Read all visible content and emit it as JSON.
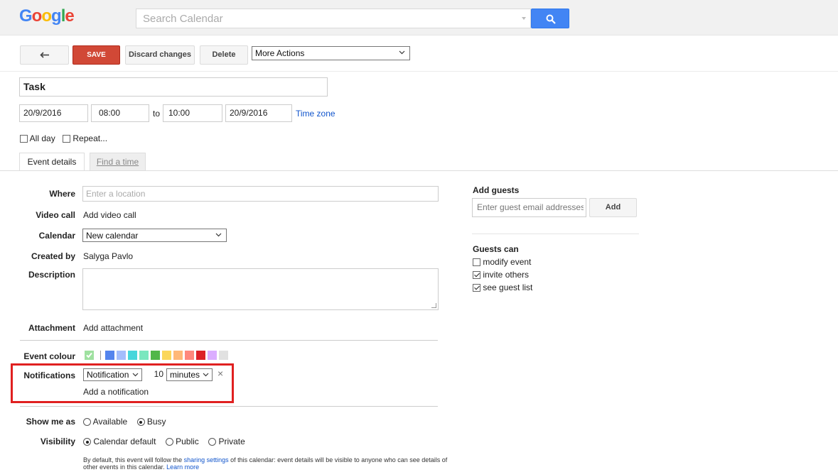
{
  "header": {
    "logo_letters": [
      {
        "ch": "G",
        "color": "#4285f4"
      },
      {
        "ch": "o",
        "color": "#ea4335"
      },
      {
        "ch": "o",
        "color": "#fbbc05"
      },
      {
        "ch": "g",
        "color": "#4285f4"
      },
      {
        "ch": "l",
        "color": "#34a853"
      },
      {
        "ch": "e",
        "color": "#ea4335"
      }
    ],
    "search_placeholder": "Search Calendar",
    "search_icon": "search-icon"
  },
  "toolbar": {
    "back_icon": "back-arrow-icon",
    "save_label": "SAVE",
    "discard_label": "Discard changes",
    "delete_label": "Delete",
    "more_actions_label": "More Actions"
  },
  "event": {
    "title": "Task",
    "start_date": "20/9/2016",
    "start_time": "08:00",
    "to_label": "to",
    "end_time": "10:00",
    "end_date": "20/9/2016",
    "timezone_link": "Time zone",
    "all_day_label": "All day",
    "all_day_checked": false,
    "repeat_label": "Repeat...",
    "repeat_checked": false
  },
  "tabs": [
    {
      "label": "Event details",
      "active": true
    },
    {
      "label": "Find a time",
      "active": false
    }
  ],
  "details": {
    "where_label": "Where",
    "where_placeholder": "Enter a location",
    "video_label": "Video call",
    "video_link": "Add video call",
    "calendar_label": "Calendar",
    "calendar_value": "New calendar",
    "created_label": "Created by",
    "created_value": "Salyga Pavlo",
    "description_label": "Description",
    "attachment_label": "Attachment",
    "attachment_link": "Add attachment",
    "colour_label": "Event colour",
    "colour_swatches": [
      "#5484ed",
      "#a4bdfc",
      "#46d6db",
      "#7ae7bf",
      "#51b749",
      "#fbd75b",
      "#ffb878",
      "#ff887c",
      "#dc2127",
      "#dbadff",
      "#e1e1e1"
    ],
    "default_colour": "#9fe1a0",
    "notifications_label": "Notifications",
    "notification_type": "Notification",
    "notification_amount": "10",
    "notification_unit": "minutes",
    "add_notification_link": "Add a notification",
    "show_me_as_label": "Show me as",
    "show_options": [
      {
        "label": "Available",
        "selected": false
      },
      {
        "label": "Busy",
        "selected": true
      }
    ],
    "visibility_label": "Visibility",
    "visibility_options": [
      {
        "label": "Calendar default",
        "selected": true
      },
      {
        "label": "Public",
        "selected": false
      },
      {
        "label": "Private",
        "selected": false
      }
    ],
    "help_text_1": "By default, this event will follow the ",
    "help_link_1": "sharing settings",
    "help_text_2": " of this calendar: event details will be visible to anyone who can see details of other events in this calendar.  ",
    "help_link_2": "Learn more"
  },
  "guests": {
    "title": "Add guests",
    "input_placeholder": "Enter guest email addresses",
    "add_label": "Add",
    "can_title": "Guests can",
    "permissions": [
      {
        "label": "modify event",
        "checked": false
      },
      {
        "label": "invite others",
        "checked": true
      },
      {
        "label": "see guest list",
        "checked": true
      }
    ]
  }
}
